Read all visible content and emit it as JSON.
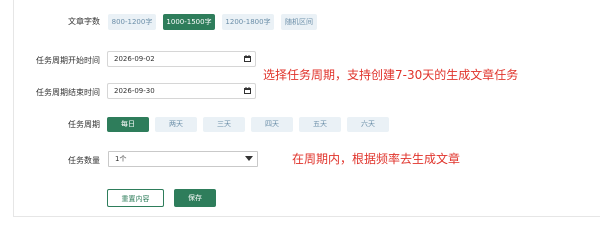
{
  "form": {
    "word_count": {
      "label": "文章字数",
      "options": [
        "800-1200字",
        "1000-1500字",
        "1200-1800字",
        "随机区间"
      ],
      "selected_index": 1
    },
    "start_date": {
      "label": "任务周期开始时间",
      "value": "2026-09-02"
    },
    "end_date": {
      "label": "任务周期结束时间",
      "value": "2026-09-30"
    },
    "period": {
      "label": "任务周期",
      "options": [
        "每日",
        "两天",
        "三天",
        "四天",
        "五天",
        "六天"
      ],
      "selected_index": 0
    },
    "quantity": {
      "label": "任务数量",
      "value": "1个"
    },
    "buttons": {
      "reset": "重置内容",
      "save": "保存"
    }
  },
  "annotations": {
    "period_note": "选择任务周期，支持创建7-30天的生成文章任务",
    "frequency_note": "在周期内，根据频率去生成文章"
  },
  "colors": {
    "accent": "#2e7d5b",
    "annotation": "#e0332b",
    "option_bg": "#eaf1f6",
    "option_text": "#6b8ea8"
  },
  "icons": {
    "calendar": "calendar-icon",
    "dropdown": "chevron-down-icon"
  }
}
